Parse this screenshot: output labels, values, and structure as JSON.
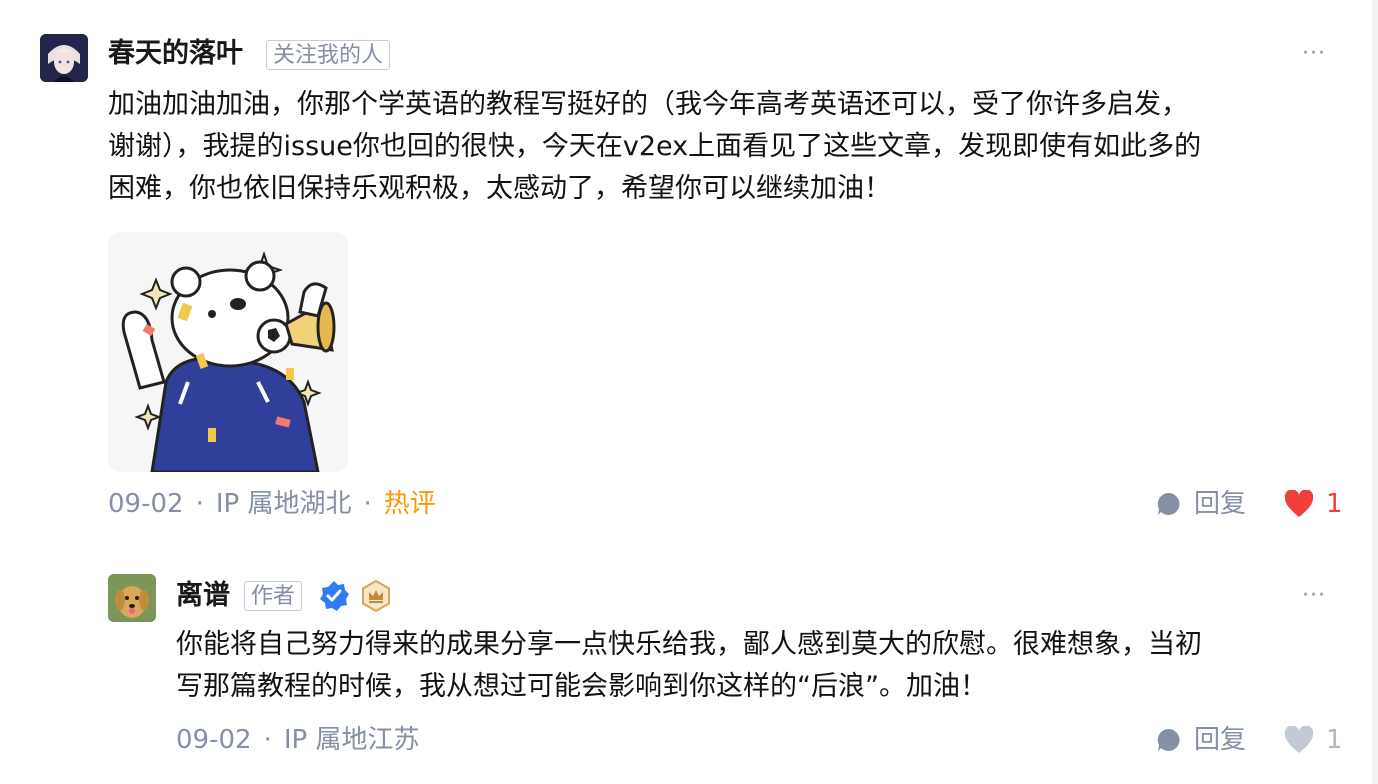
{
  "comments": [
    {
      "author": "春天的落叶",
      "tag": "关注我的人",
      "more": "···",
      "content_lines": [
        "加油加油加油，你那个学英语的教程写挺好的（我今年高考英语还可以，受了你许多启发，",
        "谢谢），我提的issue你也回的很快，今天在v2ex上面看见了这些文章，发现即使有如此多的",
        "困难，你也依旧保持乐观积极，太感动了，希望你可以继续加油！"
      ],
      "sticker": "cheering-bear-sticker",
      "date": "09-02",
      "ip": "IP 属地湖北",
      "hot": "热评",
      "reply_label": "回复",
      "likes": "1",
      "liked": true
    },
    {
      "author": "离谱",
      "tag": "作者",
      "badges": [
        "verified-icon",
        "crown-badge-icon"
      ],
      "more": "···",
      "content_lines": [
        "你能将自己努力得来的成果分享一点快乐给我，鄙人感到莫大的欣慰。很难想象，当初",
        "写那篇教程的时候，我从想过可能会影响到你这样的“后浪”。加油！"
      ],
      "date": "09-02",
      "ip": "IP 属地江苏",
      "reply_label": "回复",
      "likes": "1",
      "liked": false
    }
  ],
  "colors": {
    "meta": "#8590a6",
    "hot": "#ff9607",
    "like_active": "#f1403c",
    "verified": "#0084ff"
  }
}
